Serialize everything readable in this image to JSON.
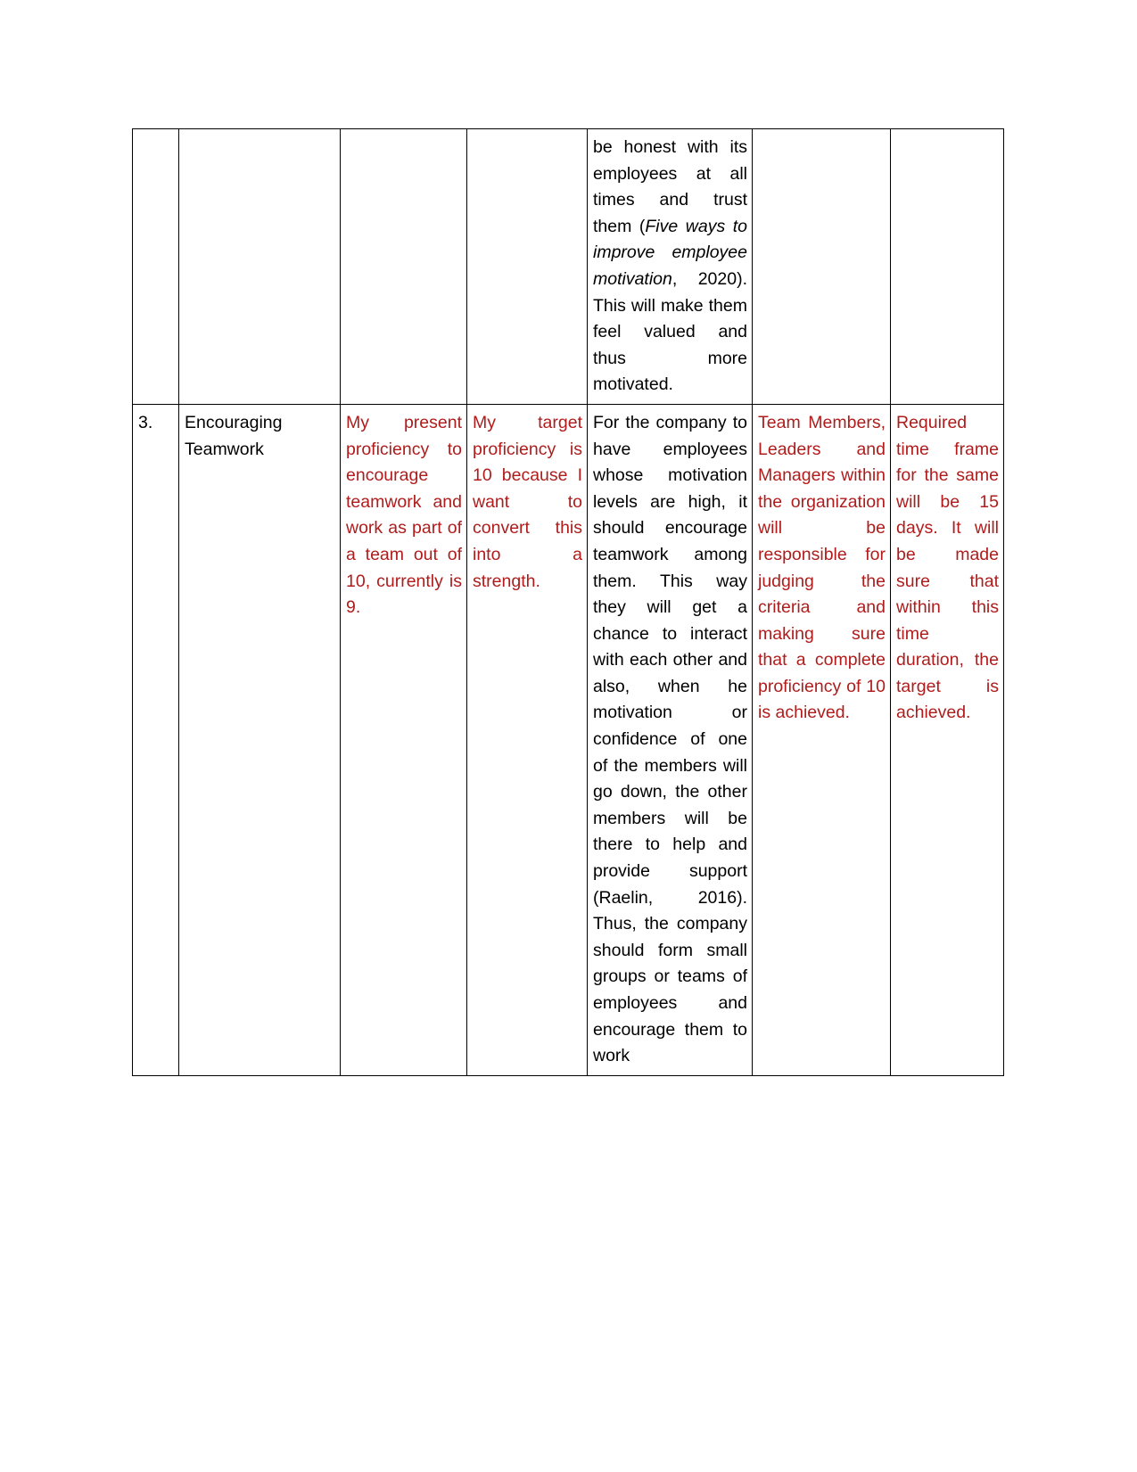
{
  "document": {
    "page_background": "#ffffff",
    "text_color_black": "#000000",
    "text_color_red": "#b01c1c",
    "table": {
      "columns": 7,
      "rows": [
        {
          "name": "continued-row",
          "cells": {
            "number": "",
            "area": "",
            "present_proficiency": "",
            "target_proficiency": "",
            "development_opportunities_pre": "be honest with its employees at all times and trust them (",
            "development_opportunities_italic": "Five ways to improve employee motivation",
            "development_opportunities_post": ", 2020). This will make them feel valued and thus more motivated.",
            "resources": "",
            "time_frame": ""
          }
        },
        {
          "name": "row-3",
          "cells": {
            "number": "3.",
            "area_line1": "Encouraging",
            "area_line2": "Teamwork",
            "present_proficiency": "My present proficiency to encourage teamwork and work as part of a team out of 10, currently is 9.",
            "target_proficiency": "My target proficiency is 10 because I want to convert this into a strength.",
            "development_opportunities_pre": "For the company to have employees whose motivation levels are high, it should encourage teamwork among them. This way they will get a chance to interact with each other and also, when he motivation or confidence of one of the members will go down, the other members will be there to help and provide support (Raelin, 2016). Thus, the company should form small groups or teams of employees and encourage them to work",
            "resources": "Team Members, Leaders and Managers within the organization will be responsible for judging the criteria and making sure that a complete proficiency of 10 is achieved.",
            "time_frame": "Required time frame for the same will be 15 days. It will be made sure that within this time duration, the target is achieved."
          }
        }
      ]
    }
  }
}
